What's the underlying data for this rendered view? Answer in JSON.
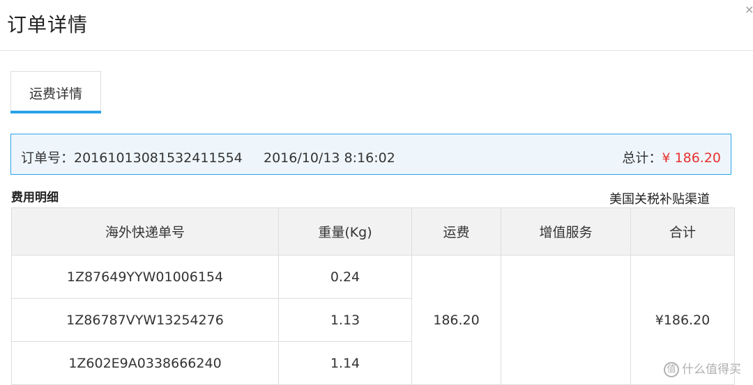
{
  "header": {
    "title": "订单详情",
    "close": "×"
  },
  "tabs": [
    {
      "label": "运费详情"
    }
  ],
  "order": {
    "order_no_text": "订单号：20161013081532411554",
    "datetime": "2016/10/13 8:16:02",
    "total_label": "总计：",
    "total_value": "¥ 186.20"
  },
  "section": {
    "title": "费用明细",
    "channel": "美国关税补贴渠道"
  },
  "table": {
    "headers": [
      "海外快递单号",
      "重量(Kg)",
      "运费",
      "增值服务",
      "合计"
    ],
    "rows": [
      {
        "tracking": "1Z87649YYW01006154",
        "weight": "0.24"
      },
      {
        "tracking": "1Z86787VYW13254276",
        "weight": "1.13"
      },
      {
        "tracking": "1Z602E9A0338666240",
        "weight": "1.14"
      }
    ],
    "shipping_fee": "186.20",
    "value_added": "",
    "subtotal": "¥186.20"
  },
  "watermark": {
    "icon_text": "值",
    "text": "什么值得买"
  },
  "colors": {
    "accent": "#2aa3e8",
    "price": "#e6312f",
    "header_bg": "#f2f2f2",
    "bar_bg": "#eef6fc"
  }
}
